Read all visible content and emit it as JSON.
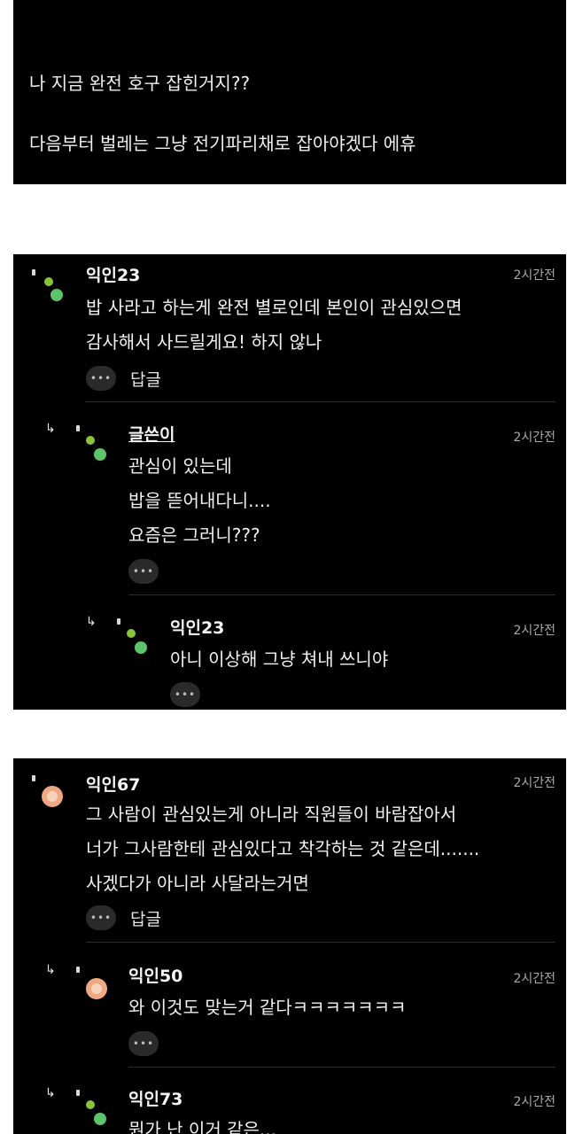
{
  "post": {
    "line1": "나 지금 완전 호구 잡힌거지??",
    "line2": "다음부터 벌레는 그냥 전기파리채로 잡아야겠다 에휴"
  },
  "thread1": {
    "comment": {
      "author": "익인23",
      "time": "2시간전",
      "lines": [
        "밥 사라고 하는게 완전 별로인데 본인이 관심있으면",
        "감사해서 사드릴게요! 하지 않나"
      ],
      "more": "•••",
      "reply_label": "답글"
    },
    "reply1": {
      "author": "글쓴이",
      "time": "2시간전",
      "lines": [
        "관심이 있는데",
        "밥을 뜯어내다니....",
        "요즘은 그러니???"
      ],
      "more": "•••"
    },
    "reply2": {
      "author": "익인23",
      "time": "2시간전",
      "lines": [
        "아니 이상해 그냥 쳐내 쓰니야"
      ],
      "more": "•••"
    }
  },
  "thread2": {
    "comment": {
      "author": "익인67",
      "time": "2시간전",
      "lines": [
        "그 사람이 관심있는게 아니라 직원들이 바람잡아서",
        "너가 그사람한테 관심있다고 착각하는 것 같은데.......",
        "사겠다가 아니라 사달라는거면"
      ],
      "more": "•••",
      "reply_label": "답글"
    },
    "reply1": {
      "author": "익인50",
      "time": "2시간전",
      "lines": [
        "와 이것도 맞는거 같다ㅋㅋㅋㅋㅋㅋㅋ"
      ],
      "more": "•••"
    },
    "reply2": {
      "author": "익인73",
      "time": "2시간전",
      "lines": [
        "뭔가 난 이거 같은..."
      ]
    }
  },
  "colors": {
    "card_bg": "#000000",
    "page_bg": "#ffffff",
    "avatar_green": "#5cc46a",
    "avatar_lime": "#8ac23a",
    "avatar_orange": "#f0a880"
  },
  "icons": {
    "reply_arrow": "↳",
    "more": "more-dots-icon"
  }
}
